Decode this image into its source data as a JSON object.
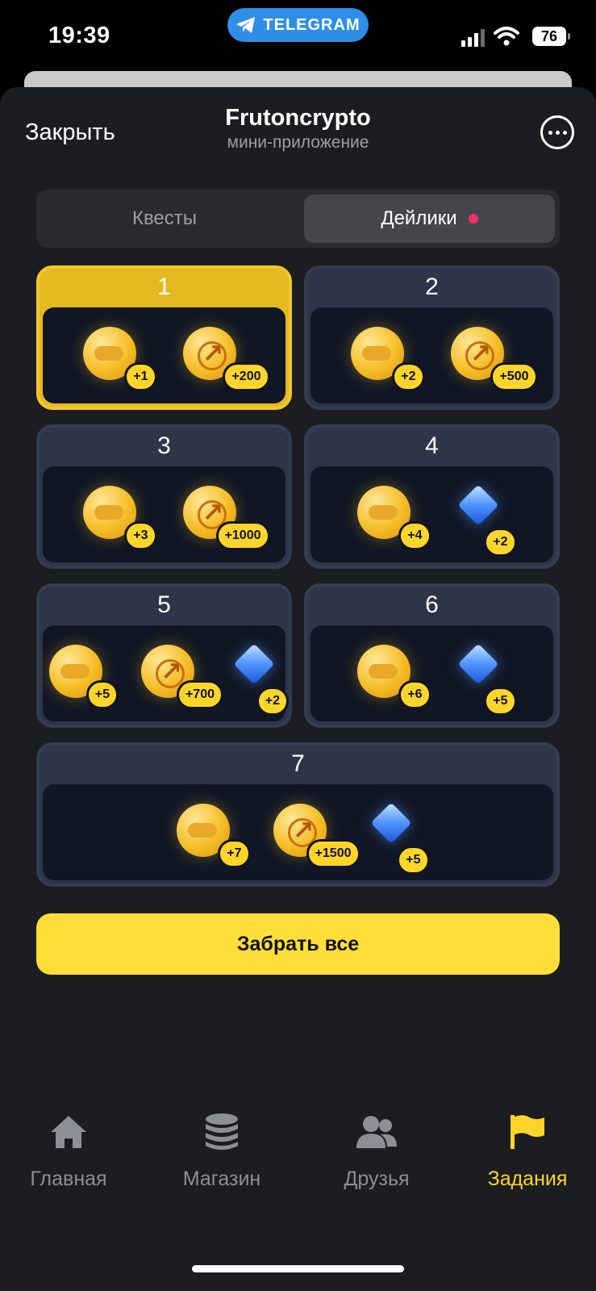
{
  "status_bar": {
    "time": "19:39",
    "pill_label": "TELEGRAM",
    "battery": "76"
  },
  "header": {
    "close_label": "Закрыть",
    "title": "Frutoncrypto",
    "subtitle": "мини-приложение"
  },
  "tabs": [
    {
      "label": "Квесты",
      "active": false
    },
    {
      "label": "Дейлики",
      "active": true,
      "has_dot": true
    }
  ],
  "days": [
    {
      "day": "1",
      "active": true,
      "rewards": [
        {
          "type": "game-coin",
          "amount": "+1"
        },
        {
          "type": "crypto-coin",
          "amount": "+200"
        }
      ]
    },
    {
      "day": "2",
      "active": false,
      "rewards": [
        {
          "type": "game-coin",
          "amount": "+2"
        },
        {
          "type": "crypto-coin",
          "amount": "+500"
        }
      ]
    },
    {
      "day": "3",
      "active": false,
      "rewards": [
        {
          "type": "game-coin",
          "amount": "+3"
        },
        {
          "type": "crypto-coin",
          "amount": "+1000"
        }
      ]
    },
    {
      "day": "4",
      "active": false,
      "rewards": [
        {
          "type": "game-coin",
          "amount": "+4"
        },
        {
          "type": "gem",
          "amount": "+2"
        }
      ]
    },
    {
      "day": "5",
      "active": false,
      "rewards": [
        {
          "type": "game-coin",
          "amount": "+5"
        },
        {
          "type": "crypto-coin",
          "amount": "+700"
        },
        {
          "type": "gem",
          "amount": "+2"
        }
      ]
    },
    {
      "day": "6",
      "active": false,
      "rewards": [
        {
          "type": "game-coin",
          "amount": "+6"
        },
        {
          "type": "gem",
          "amount": "+5"
        }
      ]
    },
    {
      "day": "7",
      "active": false,
      "rewards": [
        {
          "type": "game-coin",
          "amount": "+7"
        },
        {
          "type": "crypto-coin",
          "amount": "+1500"
        },
        {
          "type": "gem",
          "amount": "+5"
        }
      ]
    }
  ],
  "claim_all_label": "Забрать все",
  "nav": [
    {
      "label": "Главная",
      "icon": "home-icon",
      "active": false
    },
    {
      "label": "Магазин",
      "icon": "coins-stack-icon",
      "active": false
    },
    {
      "label": "Друзья",
      "icon": "friends-icon",
      "active": false
    },
    {
      "label": "Задания",
      "icon": "flag-icon",
      "active": true
    }
  ],
  "colors": {
    "accent": "#ffd52a",
    "sheet_bg": "#1c1d20",
    "card_bg": "#2f3548",
    "active_card": "#e6b922",
    "tab_dot": "#f0306a",
    "telegram_blue": "#2f8fe6"
  }
}
